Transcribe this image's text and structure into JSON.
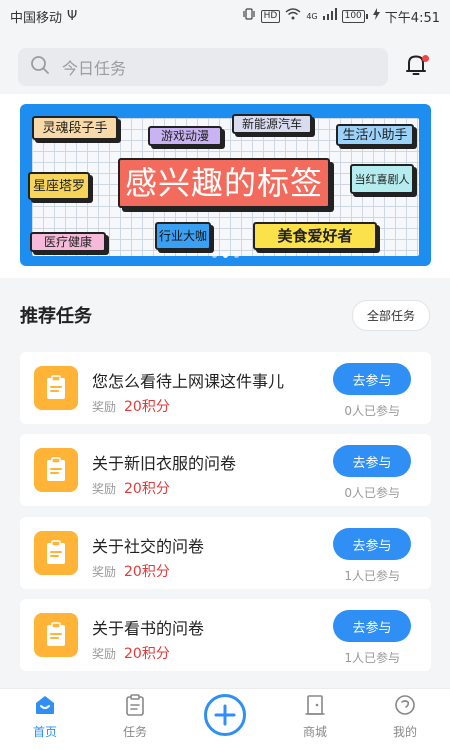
{
  "status_bar": {
    "carrier": "中国移动",
    "usb": "Ψ",
    "hd": "HD",
    "network": "4G",
    "battery": "100",
    "time": "下午4:51"
  },
  "search": {
    "placeholder": "今日任务"
  },
  "banner": {
    "main_tag": "感兴趣的标签",
    "tags": [
      "灵魂段子手",
      "游戏动漫",
      "新能源汽车",
      "生活小助手",
      "星座塔罗",
      "当红喜剧人",
      "医疗健康",
      "行业大咖",
      "美食爱好者"
    ]
  },
  "section": {
    "title": "推荐任务",
    "all_button": "全部任务"
  },
  "tasks": [
    {
      "title": "您怎么看待上网课这件事儿",
      "reward_label": "奖励",
      "points": "20积分",
      "button": "去参与",
      "joined": "0人已参与"
    },
    {
      "title": "关于新旧衣服的问卷",
      "reward_label": "奖励",
      "points": "20积分",
      "button": "去参与",
      "joined": "0人已参与"
    },
    {
      "title": "关于社交的问卷",
      "reward_label": "奖励",
      "points": "20积分",
      "button": "去参与",
      "joined": "1人已参与"
    },
    {
      "title": "关于看书的问卷",
      "reward_label": "奖励",
      "points": "20积分",
      "button": "去参与",
      "joined": "1人已参与"
    }
  ],
  "bottom_nav": {
    "home": "首页",
    "tasks": "任务",
    "mall": "商城",
    "mine": "我的"
  },
  "colors": {
    "accent": "#2f8ff5",
    "points": "#e23b3b",
    "task_icon": "#ffb437"
  }
}
